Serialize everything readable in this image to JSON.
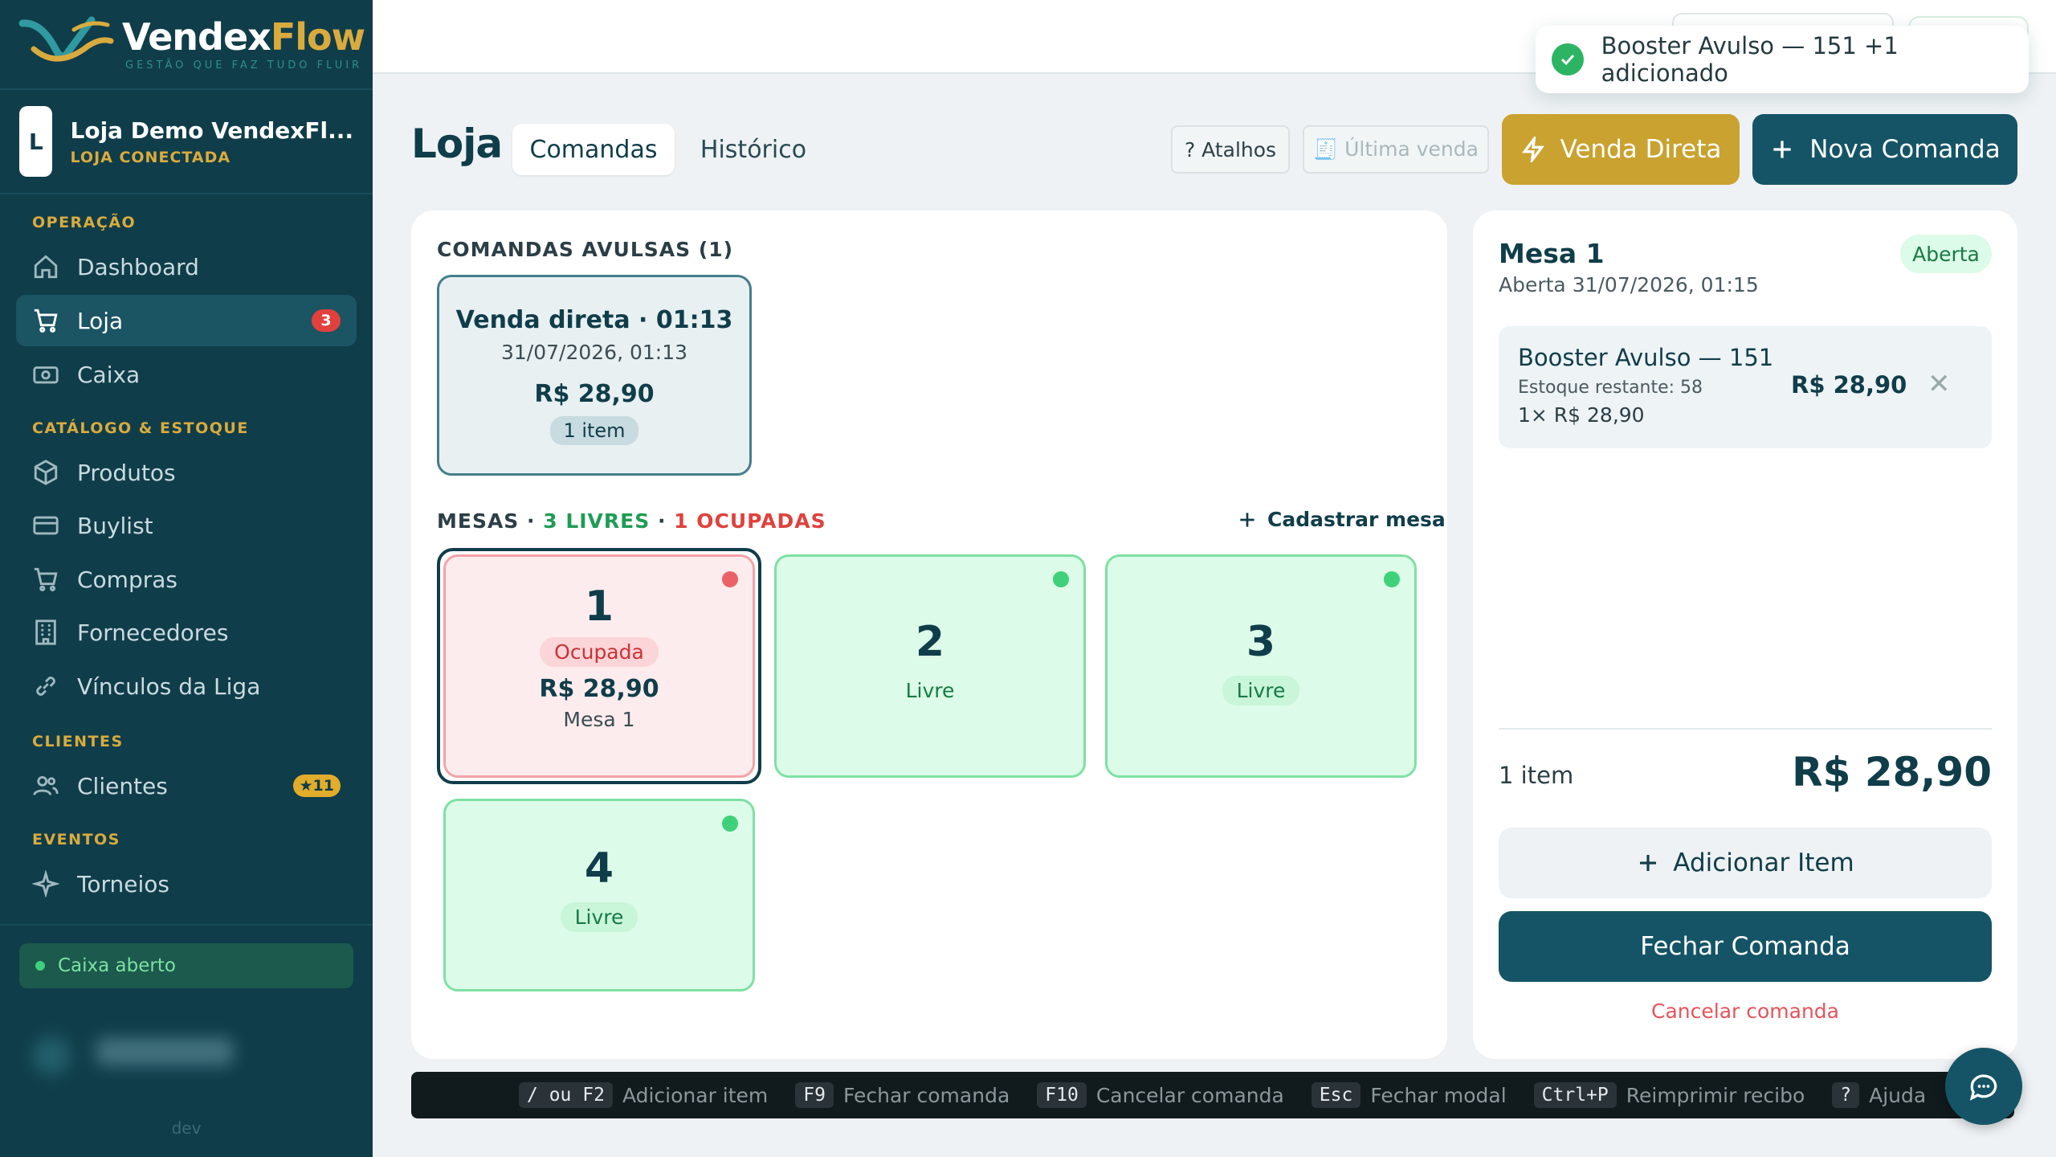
{
  "brand": {
    "name_a": "Vendex",
    "name_b": "Flow",
    "tagline": "GESTÃO QUE FAZ TUDO FLUIR"
  },
  "store": {
    "initial": "L",
    "name": "Loja Demo VendexFl...",
    "status": "LOJA CONECTADA"
  },
  "sidebar": {
    "sections": {
      "operacao": "OPERAÇÃO",
      "catalogo": "CATÁLOGO & ESTOQUE",
      "clientes": "CLIENTES",
      "eventos": "EVENTOS"
    },
    "items": [
      {
        "label": "Dashboard",
        "icon": "home-icon"
      },
      {
        "label": "Loja",
        "icon": "cart-icon",
        "badge": "3",
        "active": true
      },
      {
        "label": "Caixa",
        "icon": "cash-icon"
      },
      {
        "label": "Produtos",
        "icon": "box-icon"
      },
      {
        "label": "Buylist",
        "icon": "card-icon"
      },
      {
        "label": "Compras",
        "icon": "cart-icon"
      },
      {
        "label": "Fornecedores",
        "icon": "building-icon"
      },
      {
        "label": "Vínculos da Liga",
        "icon": "link-icon"
      },
      {
        "label": "Clientes",
        "icon": "users-icon",
        "badge": "★11"
      },
      {
        "label": "Torneios",
        "icon": "sparkle-icon"
      }
    ],
    "caixa_status": "Caixa aberto",
    "footer": "dev"
  },
  "toast": {
    "message": "Booster Avulso — 151 +1 adicionado"
  },
  "header": {
    "title": "Loja",
    "tabs": [
      "Comandas",
      "Histórico"
    ],
    "atalhos": "? Atalhos",
    "ultima_venda": "🧾 Última venda",
    "venda_direta": "Venda Direta",
    "nova_comanda": "Nova Comanda"
  },
  "comandas": {
    "avulsas_label": "COMANDAS AVULSAS (1)",
    "avulsa": {
      "title": "Venda direta · 01:13",
      "date": "31/07/2026, 01:13",
      "price": "R$ 28,90",
      "items": "1 item"
    },
    "mesas_label": "MESAS · ",
    "livres": "3 LIVRES",
    "sep": " · ",
    "ocupadas": "1 OCUPADAS",
    "add_mesa": "Cadastrar mesa",
    "mesas": [
      {
        "num": "1",
        "status": "Ocupada",
        "price": "R$ 28,90",
        "name": "Mesa 1"
      },
      {
        "num": "2",
        "status": "Livre"
      },
      {
        "num": "3",
        "status": "Livre"
      },
      {
        "num": "4",
        "status": "Livre"
      }
    ]
  },
  "detail": {
    "title": "Mesa 1",
    "opened": "Aberta 31/07/2026, 01:15",
    "status": "Aberta",
    "item": {
      "name": "Booster Avulso — 151",
      "stock": "Estoque restante: 58",
      "qty": "1× R$ 28,90",
      "price": "R$ 28,90",
      "remove": "✕"
    },
    "count": "1 item",
    "total": "R$ 28,90",
    "add_item": "Adicionar Item",
    "close": "Fechar Comanda",
    "cancel": "Cancelar comanda"
  },
  "shortcuts": [
    {
      "key": "/ ou F2",
      "label": "Adicionar item"
    },
    {
      "key": "F9",
      "label": "Fechar comanda"
    },
    {
      "key": "F10",
      "label": "Cancelar comanda"
    },
    {
      "key": "Esc",
      "label": "Fechar modal"
    },
    {
      "key": "Ctrl+P",
      "label": "Reimprimir recibo"
    },
    {
      "key": "?",
      "label": "Ajuda"
    }
  ],
  "colors": {
    "primary": "#155467",
    "gold": "#c9a22f",
    "sidebar": "#103d4a",
    "free": "#dcfbe8",
    "occupied": "#fdeced"
  }
}
